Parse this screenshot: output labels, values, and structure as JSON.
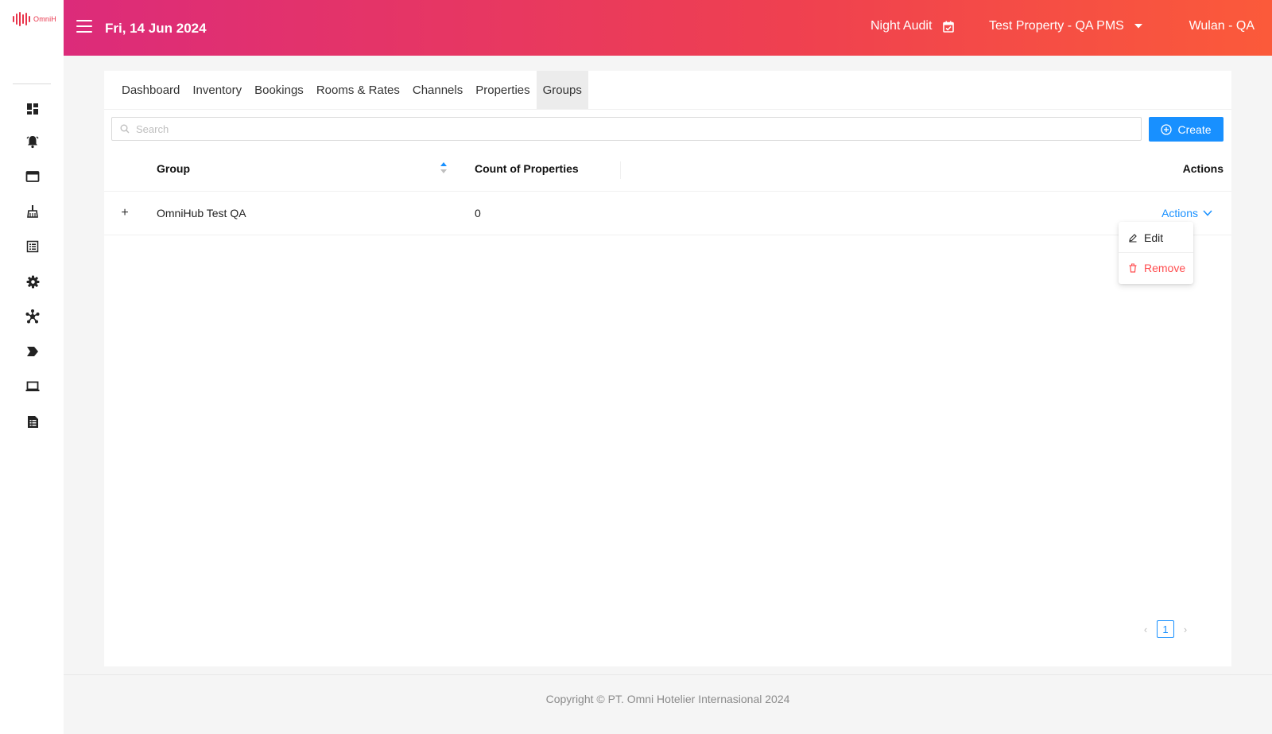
{
  "brand": {
    "logo_text": "OmniH",
    "accent": "#e8334a"
  },
  "header": {
    "date": "Fri, 14 Jun 2024",
    "night_audit": "Night Audit",
    "property": "Test Property - QA PMS",
    "user": "Wulan - QA",
    "gradient": [
      "#dc2b7a",
      "#ef4050",
      "#fb5a3a"
    ]
  },
  "sidebar": {
    "items": [
      {
        "icon": "dashboard-icon"
      },
      {
        "icon": "bell-icon"
      },
      {
        "icon": "window-icon"
      },
      {
        "icon": "broom-icon"
      },
      {
        "icon": "list-icon"
      },
      {
        "icon": "gear-icon"
      },
      {
        "icon": "network-icon"
      },
      {
        "icon": "arrow-tag-icon"
      },
      {
        "icon": "laptop-icon"
      },
      {
        "icon": "report-icon"
      }
    ]
  },
  "tabs": [
    {
      "label": "Dashboard"
    },
    {
      "label": "Inventory"
    },
    {
      "label": "Bookings"
    },
    {
      "label": "Rooms & Rates"
    },
    {
      "label": "Channels"
    },
    {
      "label": "Properties"
    },
    {
      "label": "Groups",
      "active": true
    }
  ],
  "search": {
    "placeholder": "Search",
    "value": ""
  },
  "create_label": "Create",
  "table": {
    "columns": {
      "group": "Group",
      "count": "Count of Properties",
      "actions": "Actions"
    },
    "rows": [
      {
        "expand": "+",
        "group": "OmniHub Test QA",
        "count": "0",
        "actions": "Actions"
      }
    ]
  },
  "dropdown": {
    "edit": "Edit",
    "remove": "Remove"
  },
  "pagination": {
    "current": "1",
    "prev": "‹",
    "next": "›"
  },
  "footer": "Copyright © PT. Omni Hotelier Internasional 2024",
  "colors": {
    "primary": "#1890ff",
    "danger": "#ff4d4f"
  }
}
